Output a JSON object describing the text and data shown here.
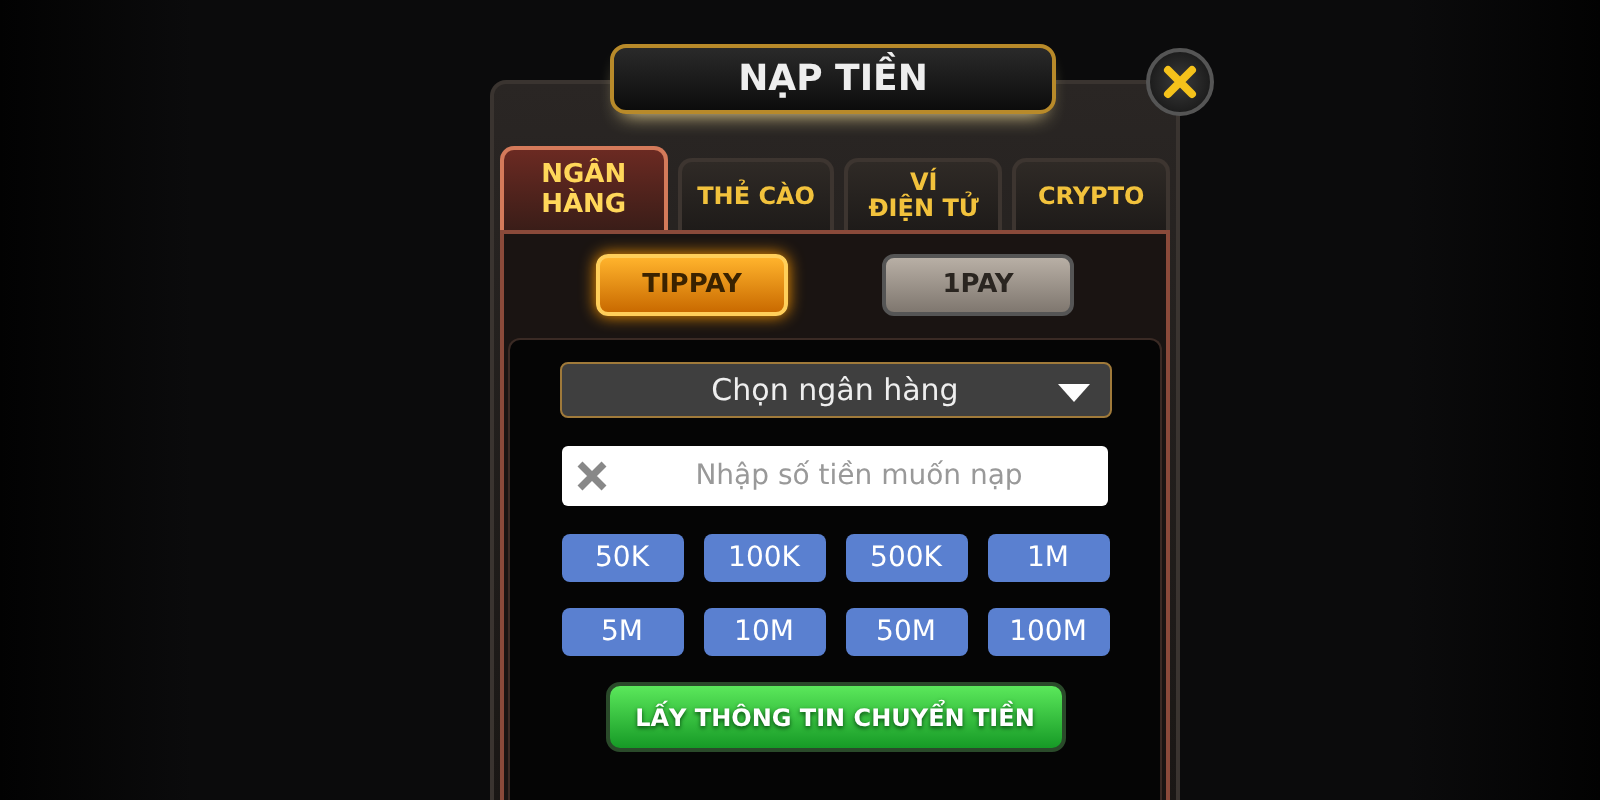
{
  "dialog": {
    "title": "NẠP TIỀN",
    "tabs": [
      {
        "label": "NGÂN\nHÀNG",
        "selected": true
      },
      {
        "label": "THẺ CÀO",
        "selected": false
      },
      {
        "label": "VÍ\nĐIỆN TỬ",
        "selected": false
      },
      {
        "label": "CRYPTO",
        "selected": false
      }
    ],
    "providers": [
      {
        "label": "TIPPAY",
        "selected": true
      },
      {
        "label": "1PAY",
        "selected": false
      }
    ],
    "bank_select": {
      "value": "Chọn ngân hàng"
    },
    "amount_field": {
      "placeholder": "Nhập số tiền muốn nạp"
    },
    "amounts": [
      "50K",
      "100K",
      "500K",
      "1M",
      "5M",
      "10M",
      "50M",
      "100M"
    ],
    "submit_button": "LẤY THÔNG TIN CHUYỂN TIỀN"
  }
}
